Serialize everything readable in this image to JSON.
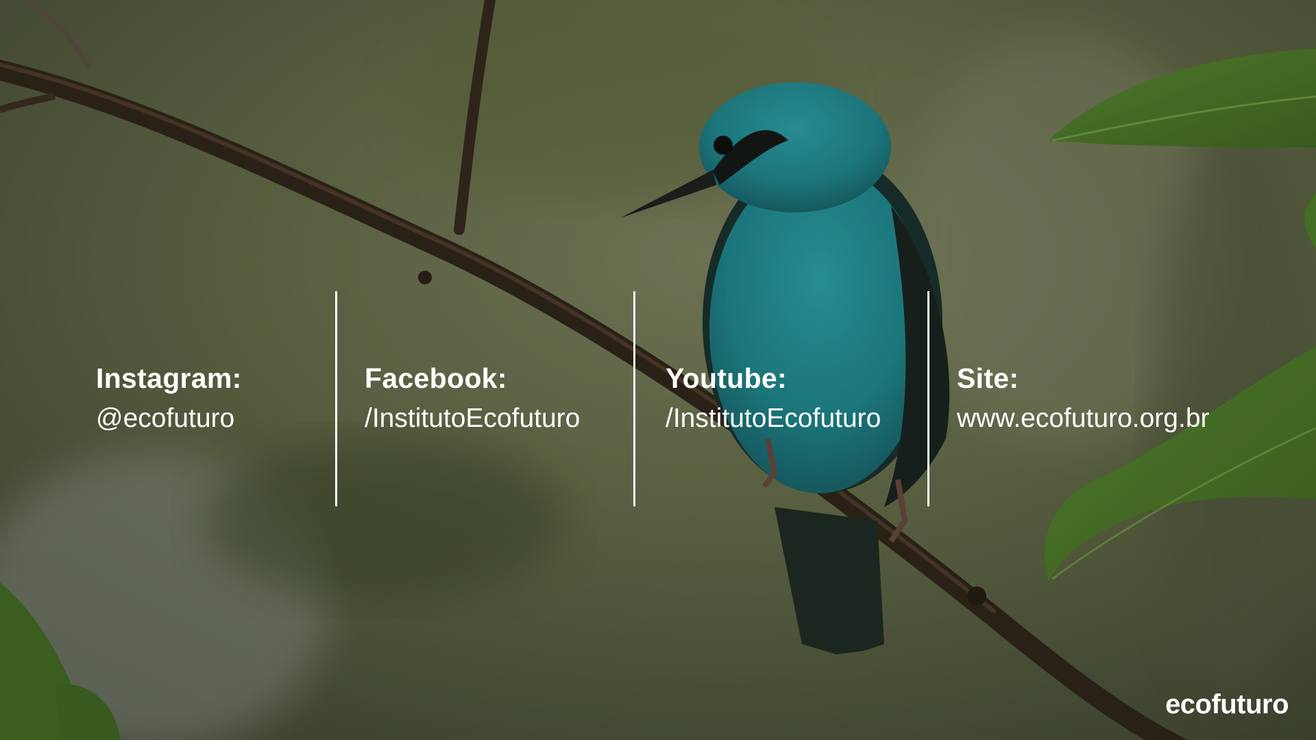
{
  "contacts": {
    "instagram": {
      "label": "Instagram:",
      "value": "@ecofuturo"
    },
    "facebook": {
      "label": "Facebook:",
      "value": "/InstitutoEcofuturo"
    },
    "youtube": {
      "label": "Youtube:",
      "value": "/InstitutoEcofuturo"
    },
    "site": {
      "label": "Site:",
      "value": "www.ecofuturo.org.br"
    }
  },
  "logo": {
    "text": "ecofuturo"
  },
  "colors": {
    "text": "#ffffff",
    "background": "#5b6446",
    "bird": "#1f8a96",
    "branch": "#3a2a1c",
    "leaf": "#4e7a2a"
  }
}
